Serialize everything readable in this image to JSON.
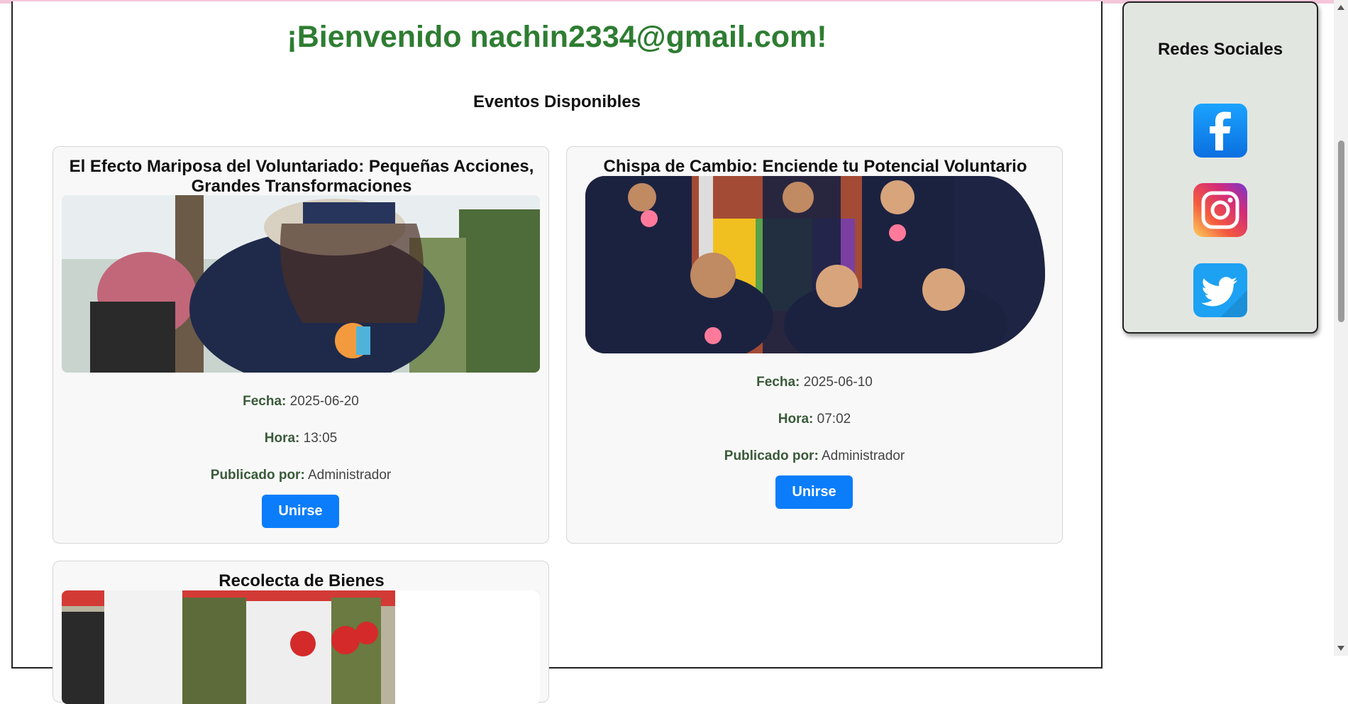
{
  "welcome": {
    "text": "¡Bienvenido nachin2334@gmail.com!"
  },
  "events_section": {
    "title": "Eventos Disponibles"
  },
  "events": [
    {
      "title": "El Efecto Mariposa del Voluntariado: Pequeñas Acciones, Grandes Transformaciones",
      "fecha_label": "Fecha:",
      "fecha": "2025-06-20",
      "hora_label": "Hora:",
      "hora": "13:05",
      "publicado_label": "Publicado por:",
      "publicado": "Administrador",
      "button": "Unirse"
    },
    {
      "title": "Chispa de Cambio: Enciende tu Potencial Voluntario",
      "fecha_label": "Fecha:",
      "fecha": "2025-06-10",
      "hora_label": "Hora:",
      "hora": "07:02",
      "publicado_label": "Publicado por:",
      "publicado": "Administrador",
      "button": "Unirse"
    },
    {
      "title": "Recolecta de Bienes"
    }
  ],
  "social": {
    "title": "Redes Sociales",
    "icons": [
      "facebook-icon",
      "instagram-icon",
      "twitter-icon"
    ]
  },
  "colors": {
    "welcome": "#2e7d32",
    "button": "#0b7dfa",
    "social_bg": "#e2e6e1",
    "top_strip": "#f4c6d9"
  }
}
